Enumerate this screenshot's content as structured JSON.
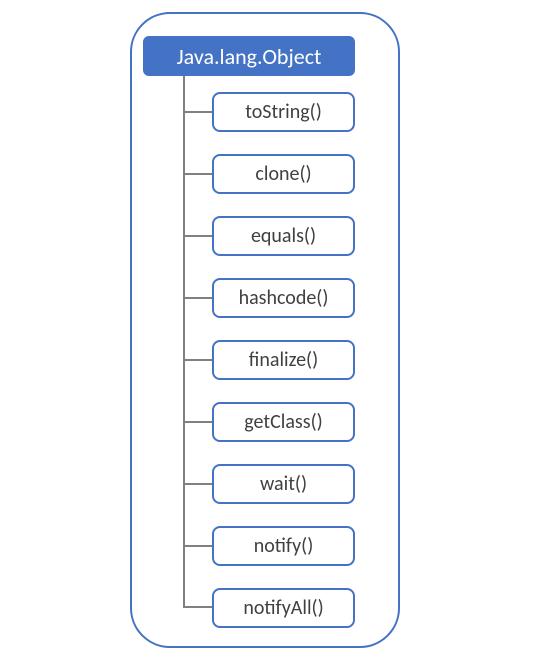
{
  "diagram": {
    "root_label": "Java.lang.Object",
    "methods": [
      "toString()",
      "clone()",
      "equals()",
      "hashcode()",
      "finalize()",
      "getClass()",
      "wait()",
      "notify()",
      "notifyAll()"
    ],
    "colors": {
      "primary": "#4472c4",
      "text_light": "#ffffff",
      "text_dark": "#404040",
      "line": "#808080"
    }
  }
}
